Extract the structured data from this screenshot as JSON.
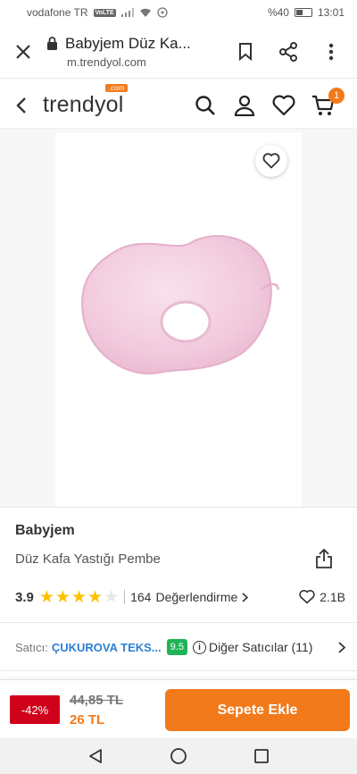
{
  "status_bar": {
    "carrier": "vodafone TR",
    "volte": "VoLTE",
    "battery": "%40",
    "time": "13:01"
  },
  "browser": {
    "title": "Babyjem Düz Ka...",
    "url": "m.trendyol.com"
  },
  "site_header": {
    "logo": "trendyol",
    "logo_badge": ".com",
    "cart_count": "1"
  },
  "product": {
    "brand": "Babyjem",
    "name": "Düz Kafa Yastığı Pembe",
    "rating": "3.9",
    "stars_filled": 4,
    "stars_total": 5,
    "reviews_count": "164",
    "reviews_label": "Değerlendirme",
    "favorites": "2.1B"
  },
  "seller": {
    "label": "Satıcı:",
    "name": "ÇUKUROVA TEKS...",
    "score": "9.5",
    "other_sellers": "Diğer Satıcılar (11)"
  },
  "pricing": {
    "discount": "-42%",
    "old_price": "44,85 TL",
    "new_price": "26 TL",
    "add_to_cart": "Sepete Ekle"
  },
  "colors": {
    "brand_orange": "#f27a1a",
    "discount_red": "#d0021b",
    "star_yellow": "#ffc000",
    "seller_green": "#1fb355",
    "seller_blue": "#2d7fd3",
    "pillow_pink": "#f3cfe0"
  }
}
